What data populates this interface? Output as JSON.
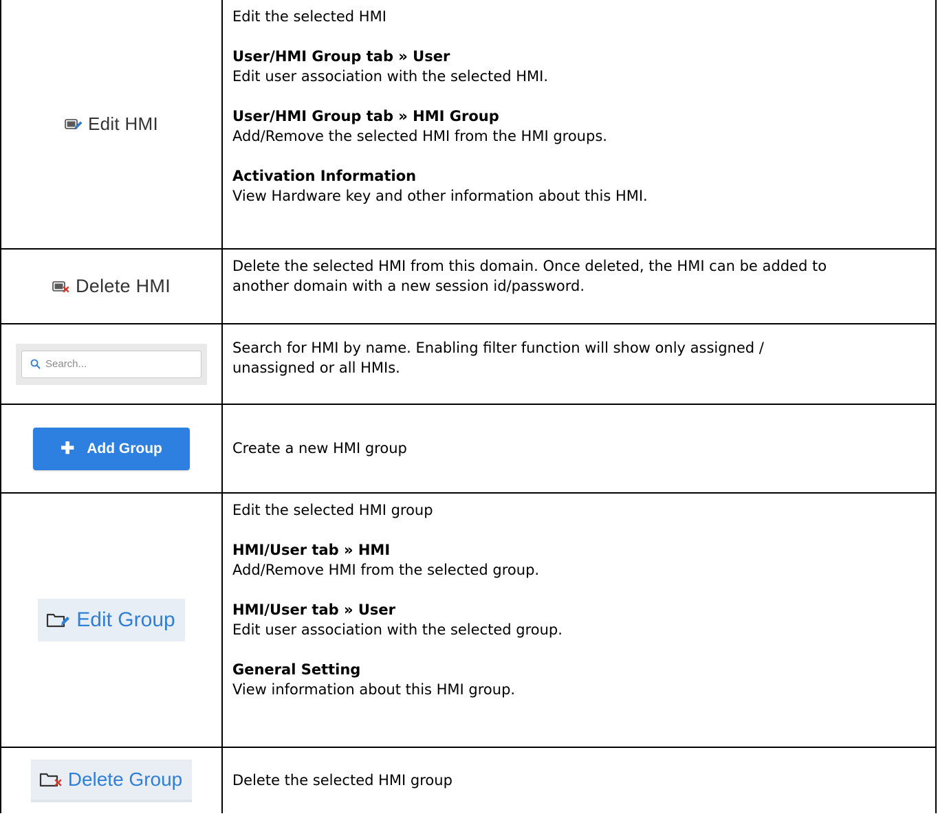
{
  "rows": [
    {
      "widget": {
        "type": "icon-text",
        "label": "Edit HMI",
        "icon": "edit-hmi-icon"
      },
      "lines": [
        {
          "text": "Edit the selected HMI",
          "bold": false
        },
        {
          "text": "",
          "gap": true
        },
        {
          "text": "User/HMI Group tab » User",
          "bold": true
        },
        {
          "text": "Edit user association with the selected HMI.",
          "bold": false
        },
        {
          "text": "",
          "gap": true
        },
        {
          "text": "User/HMI Group tab » HMI Group",
          "bold": true
        },
        {
          "text": "Add/Remove the selected HMI from the HMI groups.",
          "bold": false
        },
        {
          "text": "",
          "gap": true
        },
        {
          "text": "Activation Information",
          "bold": true
        },
        {
          "text": "View Hardware key and other information about this HMI.",
          "bold": false
        }
      ]
    },
    {
      "widget": {
        "type": "icon-text",
        "label": "Delete HMI",
        "icon": "delete-hmi-icon"
      },
      "lines": [
        {
          "text": "Delete the selected HMI from this domain. Once deleted, the HMI can be added to",
          "bold": false
        },
        {
          "text": "another domain with a new session id/password.",
          "bold": false
        }
      ]
    },
    {
      "widget": {
        "type": "search",
        "placeholder": "Search...",
        "icon": "search-icon"
      },
      "lines": [
        {
          "text": "Search for HMI by name. Enabling filter function will show only assigned /",
          "bold": false
        },
        {
          "text": "unassigned or all HMIs.",
          "bold": false
        }
      ]
    },
    {
      "widget": {
        "type": "primary-button",
        "label": "Add Group",
        "icon": "plus-icon",
        "color": "#2e80e0"
      },
      "lines": [
        {
          "text": "Create a new HMI group",
          "bold": false
        }
      ]
    },
    {
      "widget": {
        "type": "group-button",
        "label": "Edit Group",
        "icon": "edit-folder-icon",
        "color": "#2f7fd6"
      },
      "lines": [
        {
          "text": "Edit the selected HMI group",
          "bold": false
        },
        {
          "text": "",
          "gap": true
        },
        {
          "text": "HMI/User tab » HMI",
          "bold": true
        },
        {
          "text": "Add/Remove HMI from the selected group.",
          "bold": false
        },
        {
          "text": "",
          "gap": true
        },
        {
          "text": "HMI/User tab » User",
          "bold": true
        },
        {
          "text": "Edit user association with the selected group.",
          "bold": false
        },
        {
          "text": "",
          "gap": true
        },
        {
          "text": "General Setting",
          "bold": true
        },
        {
          "text": "View information about this HMI group.",
          "bold": false
        }
      ]
    },
    {
      "widget": {
        "type": "group-button",
        "label": "Delete Group",
        "icon": "delete-folder-icon",
        "color": "#2f7fd6"
      },
      "lines": [
        {
          "text": "Delete the selected HMI group",
          "bold": false
        }
      ]
    }
  ]
}
